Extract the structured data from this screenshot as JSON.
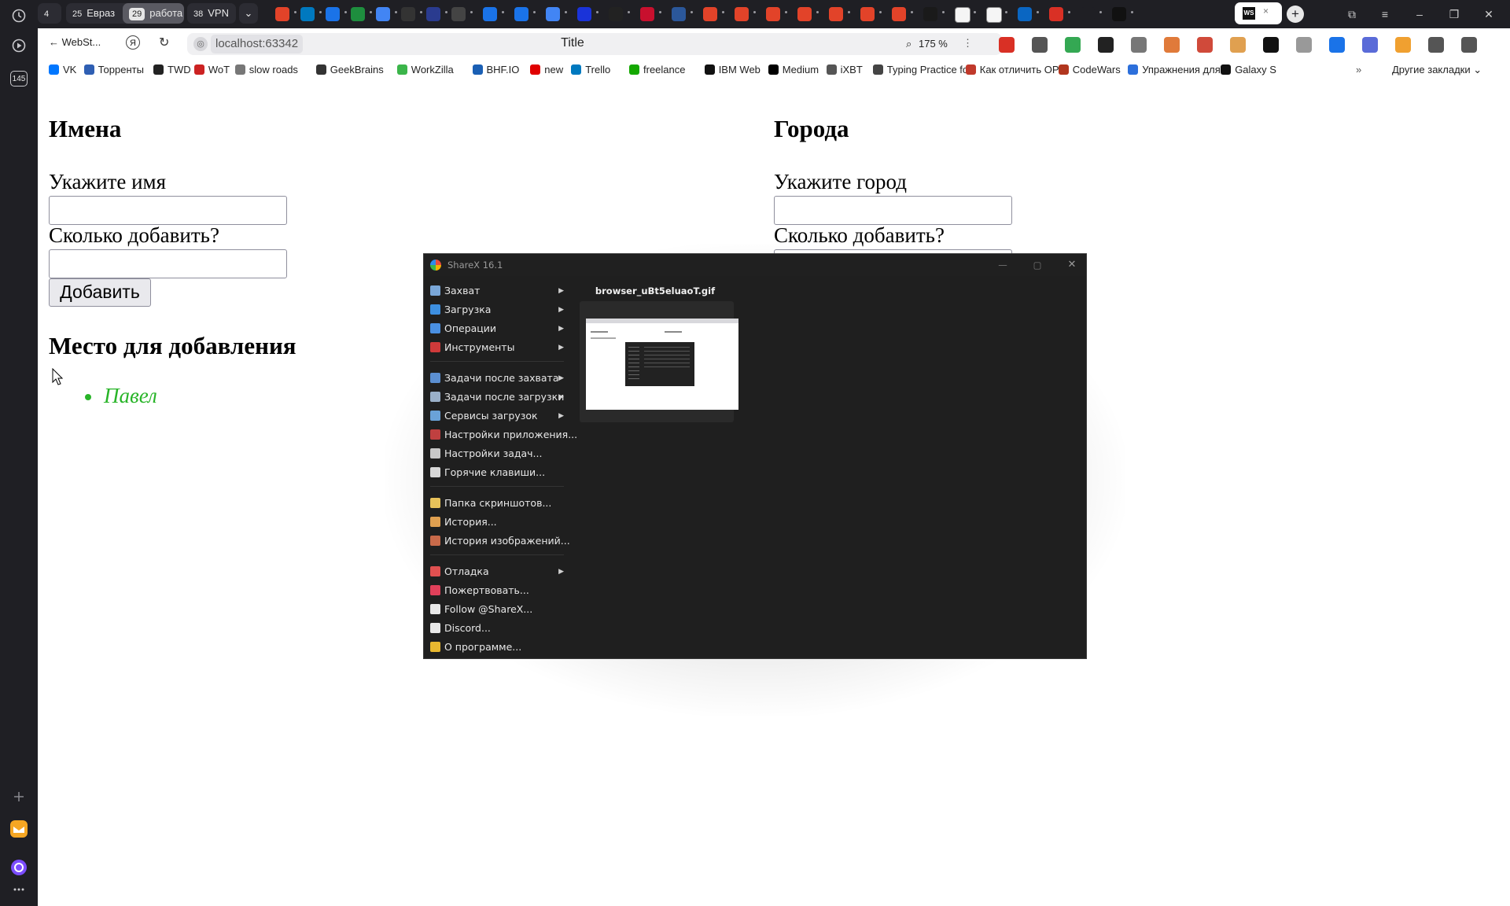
{
  "tabstrip": {
    "groups": [
      {
        "count": "4",
        "label": ""
      },
      {
        "count": "25",
        "label": "Евраз"
      },
      {
        "count": "29",
        "label": "работа"
      },
      {
        "count": "38",
        "label": "VPN"
      }
    ],
    "favicons": [
      "#e24329",
      "#0079bf",
      "#1a73e8",
      "#1e8e3e",
      "#4285f4",
      "#333333",
      "#2a3b8f",
      "#444444",
      "#1a73e8",
      "#1a73e8",
      "#4285f4",
      "#1a33d9",
      "#222222",
      "#c8102e",
      "#2b579a",
      "#e24329",
      "#e24329",
      "#e24329",
      "#e24329",
      "#e24329",
      "#e24329",
      "#e24329",
      "#1a1a1a",
      "#f5f5f5",
      "#f5f5f5",
      "#0a66c2",
      "#d93025",
      "#1f1f24",
      "#111111"
    ],
    "active_tab_icon": "webstorm-icon"
  },
  "addressbar": {
    "back_label": "WebSt...",
    "url": "localhost:63342",
    "title": "Title",
    "zoom": "175 %"
  },
  "rail": {
    "badge": "145"
  },
  "bookmarks": [
    {
      "label": "VK",
      "color": "#0077ff"
    },
    {
      "label": "Торренты",
      "color": "#2f5fb3"
    },
    {
      "label": "TWD",
      "color": "#222222"
    },
    {
      "label": "WoT",
      "color": "#cc2222"
    },
    {
      "label": "slow roads",
      "color": "#777777"
    },
    {
      "label": "GeekBrains",
      "color": "#333333"
    },
    {
      "label": "WorkZilla",
      "color": "#3bb54a"
    },
    {
      "label": "BHF.IO",
      "color": "#1a5fb4"
    },
    {
      "label": "new",
      "color": "#e00000"
    },
    {
      "label": "Trello",
      "color": "#0079bf"
    },
    {
      "label": "freelance",
      "color": "#14a800"
    },
    {
      "label": "IBM Web",
      "color": "#111111"
    },
    {
      "label": "Medium",
      "color": "#000000"
    },
    {
      "label": "iXBT",
      "color": "#555555"
    },
    {
      "label": "Typing Practice fo",
      "color": "#444444"
    },
    {
      "label": "Как отличить OPE",
      "color": "#c0392b"
    },
    {
      "label": "CodeWars",
      "color": "#b1361e"
    },
    {
      "label": "Упражнения для",
      "color": "#2c6fdb"
    },
    {
      "label": "Galaxy S",
      "color": "#111111"
    }
  ],
  "bookmarks_more": "Другие закладки",
  "page": {
    "names": {
      "heading": "Имена",
      "name_label": "Укажите имя",
      "count_label": "Сколько добавить?",
      "name_value": "",
      "count_value": "",
      "add_button": "Добавить"
    },
    "cities": {
      "heading": "Города",
      "city_label": "Укажите город",
      "count_label": "Сколько добавить?"
    },
    "place": {
      "heading": "Место для добавления",
      "items": [
        "Павел"
      ],
      "item_color": "#28b428"
    }
  },
  "sharex": {
    "title": "ShareX 16.1",
    "menu_groups": [
      [
        {
          "label": "Захват",
          "icon": "capture-icon",
          "color": "#7aa7d8",
          "submenu": true
        },
        {
          "label": "Загрузка",
          "icon": "upload-icon",
          "color": "#3d8fe0",
          "submenu": true
        },
        {
          "label": "Операции",
          "icon": "workflows-icon",
          "color": "#4a90e2",
          "submenu": true
        },
        {
          "label": "Инструменты",
          "icon": "tools-icon",
          "color": "#d03a3a",
          "submenu": true
        }
      ],
      [
        {
          "label": "Задачи после захвата",
          "icon": "after-capture-icon",
          "color": "#5b8fd1",
          "submenu": true
        },
        {
          "label": "Задачи после загрузки",
          "icon": "after-upload-icon",
          "color": "#9ab0c8",
          "submenu": true
        },
        {
          "label": "Сервисы загрузок",
          "icon": "destinations-icon",
          "color": "#6aa2d8",
          "submenu": true
        },
        {
          "label": "Настройки приложения...",
          "icon": "app-settings-icon",
          "color": "#c04040",
          "submenu": false
        },
        {
          "label": "Настройки задач...",
          "icon": "task-settings-icon",
          "color": "#c8c8c8",
          "submenu": false
        },
        {
          "label": "Горячие клавиши...",
          "icon": "hotkeys-icon",
          "color": "#d8d8d8",
          "submenu": false
        }
      ],
      [
        {
          "label": "Папка скриншотов...",
          "icon": "folder-icon",
          "color": "#e8c25a",
          "submenu": false
        },
        {
          "label": "История...",
          "icon": "history-icon",
          "color": "#e0a050",
          "submenu": false
        },
        {
          "label": "История изображений...",
          "icon": "image-history-icon",
          "color": "#c86a4a",
          "submenu": false
        }
      ],
      [
        {
          "label": "Отладка",
          "icon": "debug-icon",
          "color": "#e05050",
          "submenu": true
        },
        {
          "label": "Пожертвовать...",
          "icon": "heart-icon",
          "color": "#e0405a",
          "submenu": false
        },
        {
          "label": "Follow @ShareX...",
          "icon": "x-logo-icon",
          "color": "#e8e8e8",
          "submenu": false
        },
        {
          "label": "Discord...",
          "icon": "discord-icon",
          "color": "#e8e8e8",
          "submenu": false
        },
        {
          "label": "О программе...",
          "icon": "crown-icon",
          "color": "#e8b830",
          "submenu": false
        }
      ]
    ],
    "thumbnail": {
      "filename": "browser_uBt5eluaoT.gif"
    }
  }
}
